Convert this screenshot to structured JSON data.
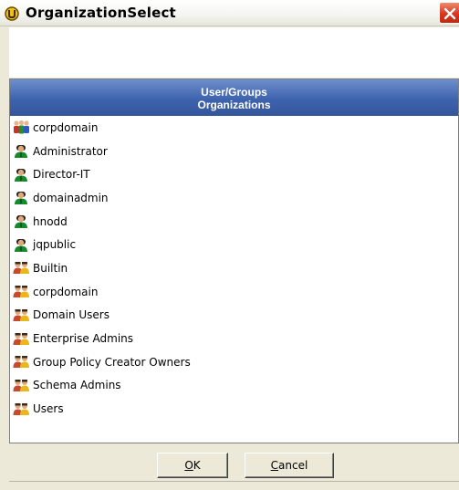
{
  "window": {
    "title": "OrganizationSelect",
    "app_icon": "organization-app-icon",
    "close_icon": "close-icon"
  },
  "panel": {
    "header_line1": "User/Groups",
    "header_line2": "Organizations",
    "header_color": "#3e63ae"
  },
  "items": [
    {
      "label": "corpdomain",
      "icon": "domain-icon"
    },
    {
      "label": "Administrator",
      "icon": "user-icon"
    },
    {
      "label": "Director-IT",
      "icon": "user-icon"
    },
    {
      "label": "domainadmin",
      "icon": "user-icon"
    },
    {
      "label": "hnodd",
      "icon": "user-icon"
    },
    {
      "label": "jqpublic",
      "icon": "user-icon"
    },
    {
      "label": "Builtin",
      "icon": "group-icon"
    },
    {
      "label": "corpdomain",
      "icon": "group-icon"
    },
    {
      "label": "Domain Users",
      "icon": "group-icon"
    },
    {
      "label": "Enterprise Admins",
      "icon": "group-icon"
    },
    {
      "label": "Group Policy Creator Owners",
      "icon": "group-icon"
    },
    {
      "label": "Schema Admins",
      "icon": "group-icon"
    },
    {
      "label": "Users",
      "icon": "group-icon"
    }
  ],
  "buttons": {
    "ok_mnemonic": "O",
    "ok_rest": "K",
    "cancel_mnemonic": "C",
    "cancel_rest": "ancel"
  }
}
